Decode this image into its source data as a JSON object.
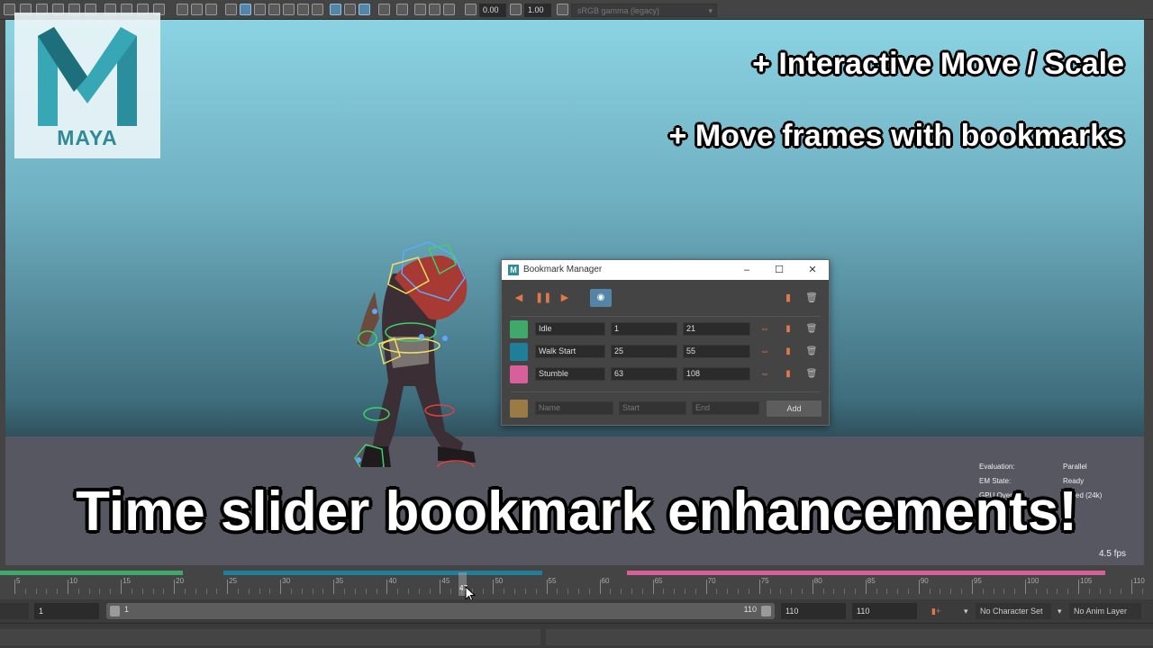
{
  "toolbar": {
    "exposure": "0.00",
    "gamma": "1.00",
    "color_space": "sRGB gamma (legacy)"
  },
  "logo": {
    "text": "MAYA"
  },
  "captions": {
    "line1": "+ Interactive Move / Scale",
    "line2": "+ Move frames with bookmarks",
    "headline": "Time slider bookmark enhancements!"
  },
  "hud": {
    "evaluation_label": "Evaluation:",
    "evaluation_value": "Parallel",
    "em_state_label": "EM State:",
    "em_state_value": "Ready",
    "gpu_override_label": "GPU Override:",
    "gpu_override_value": "ed (24k)",
    "fps": "4.5 fps"
  },
  "bookmark_manager": {
    "title": "Bookmark Manager",
    "bookmarks": [
      {
        "name": "Idle",
        "start": "1",
        "end": "21",
        "color": "#3fa86b"
      },
      {
        "name": "Walk Start",
        "start": "25",
        "end": "55",
        "color": "#1f7e9a"
      },
      {
        "name": "Stumble",
        "start": "63",
        "end": "108",
        "color": "#d8609a"
      }
    ],
    "new_entry": {
      "color": "#9c7a45",
      "name_placeholder": "Name",
      "start_placeholder": "Start",
      "end_placeholder": "End",
      "add_label": "Add"
    }
  },
  "time_slider": {
    "ticks": [
      "5",
      "10",
      "15",
      "20",
      "25",
      "30",
      "35",
      "40",
      "45",
      "50",
      "55",
      "60",
      "65",
      "70",
      "75",
      "80",
      "85",
      "90",
      "95",
      "100",
      "105",
      "110"
    ],
    "current_frame": "47"
  },
  "range_slider": {
    "start_field": "1",
    "track_start": "1",
    "track_end": "110",
    "end_field": "110",
    "anim_end_field": "110",
    "character_set": "No Character Set",
    "anim_layer": "No Anim Layer"
  },
  "colors": {
    "idle": "#3fa86b",
    "walk_start": "#1f7e9a",
    "stumble": "#d8609a",
    "accent": "#5285a6",
    "bookmark_icon": "#e0784a"
  }
}
